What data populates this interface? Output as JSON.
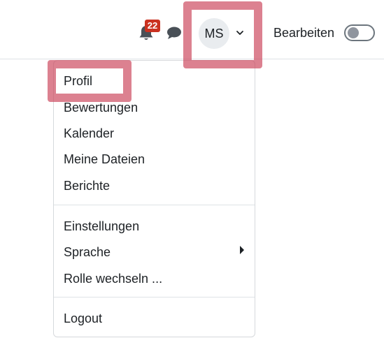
{
  "header": {
    "notification_count": "22",
    "user_initials": "MS",
    "edit_mode_label": "Bearbeiten",
    "edit_mode_on": false
  },
  "user_menu": {
    "items": [
      {
        "label": "Profil"
      },
      {
        "label": "Bewertungen"
      },
      {
        "label": "Kalender"
      },
      {
        "label": "Meine Dateien"
      },
      {
        "label": "Berichte"
      },
      {
        "label": "Einstellungen"
      },
      {
        "label": "Sprache"
      },
      {
        "label": "Rolle wechseln ..."
      },
      {
        "label": "Logout"
      }
    ]
  },
  "colors": {
    "highlight": "#cc465c",
    "badge": "#ca3120",
    "avatar_bg": "#e9ecef",
    "text": "#1d2125"
  }
}
